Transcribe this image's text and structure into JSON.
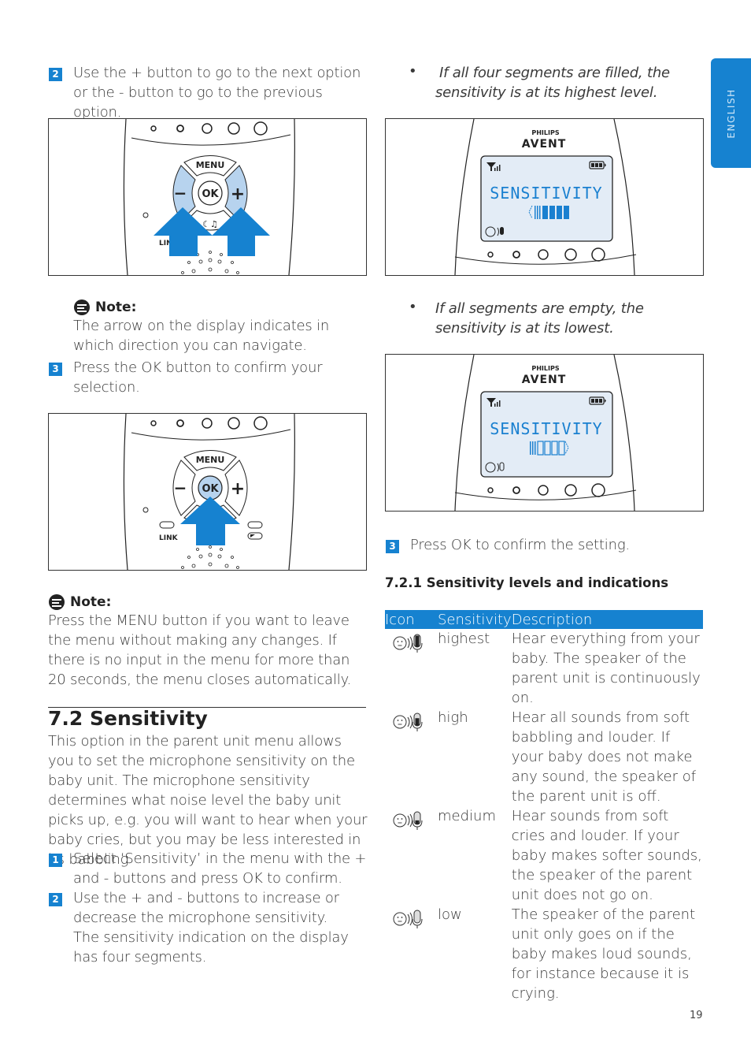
{
  "side_tab": {
    "label": "ENGLISH"
  },
  "left_column": {
    "step2_top": {
      "number": "2",
      "text": "Use the + button to go to the next option or the - button to go to the previous option."
    },
    "figure1": {
      "description": "Parent unit keypad with arrows pointing to - and + buttons",
      "labels": {
        "menu": "MENU",
        "ok": "OK",
        "minus": "−",
        "plus": "+",
        "link": "LIN"
      },
      "highlight_color": "#b7d3ee",
      "arrow_color": "#1682d0"
    },
    "note1": {
      "title": "Note:",
      "text": "The arrow on the display indicates in which direction you can navigate."
    },
    "step3_top": {
      "number": "3",
      "text": "Press the OK button to confirm your selection."
    },
    "figure2": {
      "description": "Parent unit keypad with arrow pointing to OK button",
      "labels": {
        "menu": "MENU",
        "ok": "OK",
        "minus": "−",
        "plus": "+",
        "link": "LINK"
      }
    },
    "note2": {
      "title": "Note:",
      "text": "Press the MENU button if you want to leave the menu without making any changes. If there is no input in the menu for more than 20 seconds, the menu closes automatically."
    },
    "section": {
      "title": "7.2 Sensitivity",
      "intro": "This option in the parent unit menu allows you to set the microphone sensitivity on the baby unit. The microphone sensitivity determines what noise level the baby unit picks up, e.g. you will want to hear when your baby cries, but you may be less interested in its babbling",
      "steps": [
        {
          "number": "1",
          "text": "Select ‘Sensitivity’ in the menu with the + and - buttons and press OK to confirm."
        },
        {
          "number": "2",
          "text": "Use the + and - buttons to increase or decrease the microphone sensitivity. The sensitivity indication on the display has four segments."
        }
      ]
    }
  },
  "right_column": {
    "bullet1": {
      "marker": "•",
      "text": "If all four segments are filled, the sensitivity is at its highest level."
    },
    "figure3": {
      "brand_top": "PHILIPS",
      "brand_bottom": "AVENT",
      "display_text": "SENSITIVITY",
      "segments_filled": 4,
      "segments_total": 4,
      "arrow": "left"
    },
    "bullet2": {
      "marker": "•",
      "text": "If all segments are empty, the sensitivity is at its lowest."
    },
    "figure4": {
      "brand_top": "PHILIPS",
      "brand_bottom": "AVENT",
      "display_text": "SENSITIVITY",
      "segments_filled": 0,
      "segments_total": 4,
      "arrow": "right"
    },
    "step3": {
      "number": "3",
      "text": "Press OK to confirm the setting."
    },
    "subsection_title": "7.2.1 Sensitivity levels and indications",
    "table": {
      "headers": [
        "Icon",
        "Sensitivity",
        "Description"
      ],
      "rows": [
        {
          "icon": "baby-mic-full-icon",
          "level": "highest",
          "fill": 1.0,
          "description": "Hear everything from your baby. The speaker of the parent unit is continuously on."
        },
        {
          "icon": "baby-mic-high-icon",
          "level": "high",
          "fill": 0.66,
          "description": "Hear all sounds from soft babbling and louder. If your baby does not make any sound, the speaker of the parent unit is off."
        },
        {
          "icon": "baby-mic-medium-icon",
          "level": "medium",
          "fill": 0.33,
          "description": "Hear sounds from soft cries and louder. If your baby makes softer sounds, the speaker of the parent unit does not go on."
        },
        {
          "icon": "baby-mic-low-icon",
          "level": "low",
          "fill": 0.0,
          "description": "The speaker of the parent unit only goes on if the baby makes loud sounds, for instance because it is crying."
        }
      ]
    }
  },
  "page_number": "19",
  "colors": {
    "accent": "#1682d0",
    "lcd_bg": "#e3ecf6",
    "lcd_text": "#1a80d0",
    "button_highlight": "#b7d3ee"
  }
}
